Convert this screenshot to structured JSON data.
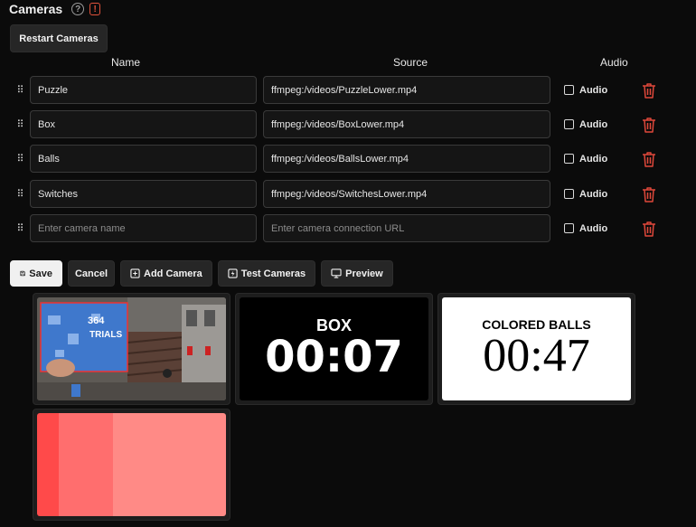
{
  "header": {
    "title": "Cameras",
    "help": "?",
    "warning": "!"
  },
  "toolbar_top": {
    "restart_label": "Restart Cameras"
  },
  "columns": {
    "name": "Name",
    "source": "Source",
    "audio": "Audio"
  },
  "cameras": [
    {
      "name": "Puzzle",
      "source": "ffmpeg:/videos/PuzzleLower.mp4",
      "audio_label": "Audio",
      "audio_checked": false
    },
    {
      "name": "Box",
      "source": "ffmpeg:/videos/BoxLower.mp4",
      "audio_label": "Audio",
      "audio_checked": false
    },
    {
      "name": "Balls",
      "source": "ffmpeg:/videos/BallsLower.mp4",
      "audio_label": "Audio",
      "audio_checked": false
    },
    {
      "name": "Switches",
      "source": "ffmpeg:/videos/SwitchesLower.mp4",
      "audio_label": "Audio",
      "audio_checked": false
    }
  ],
  "new_camera": {
    "name_placeholder": "Enter camera name",
    "source_placeholder": "Enter camera connection URL",
    "audio_label": "Audio"
  },
  "actions": {
    "save": "Save",
    "cancel": "Cancel",
    "add_camera": "Add Camera",
    "test_cameras": "Test Cameras",
    "preview": "Preview"
  },
  "previews": {
    "puzzle": {
      "overlay_lines": [
        "364",
        "TRIALS"
      ]
    },
    "box": {
      "label": "BOX",
      "time": "00:07"
    },
    "balls": {
      "label": "COLORED BALLS",
      "time": "00:47"
    },
    "switches": {
      "colors": [
        "#ff4a4a",
        "#ff6e6e",
        "#ff8a86"
      ]
    }
  },
  "colors": {
    "accent_danger": "#e0483b",
    "tile_border": "#2a2a2a"
  }
}
